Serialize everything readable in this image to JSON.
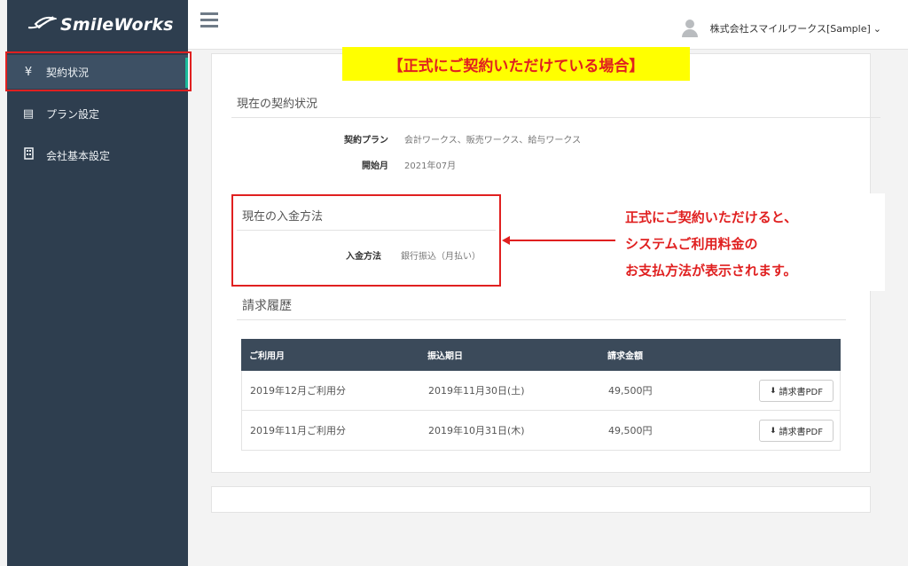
{
  "brand": {
    "logo_text": "SmileWorks"
  },
  "header": {
    "company": "株式会社スマイルワークス[Sample]",
    "chevron": "⌄"
  },
  "sidebar": {
    "items": [
      {
        "label": "契約状況",
        "icon": "yen-icon",
        "glyph": "¥",
        "active": true
      },
      {
        "label": "プラン設定",
        "icon": "list-icon",
        "glyph": "▤",
        "active": false
      },
      {
        "label": "会社基本設定",
        "icon": "building-icon",
        "glyph": "▯",
        "active": false
      }
    ]
  },
  "banner": {
    "text": "【正式にご契約いただけている場合】"
  },
  "contract": {
    "title": "現在の契約状況",
    "plan_label": "契約プラン",
    "plan_value": "会計ワークス、販売ワークス、給与ワークス",
    "start_label": "開始月",
    "start_value": "2021年07月"
  },
  "payment": {
    "title": "現在の入金方法",
    "method_label": "入金方法",
    "method_value": "銀行振込（月払い）"
  },
  "annotation": {
    "lines": [
      "正式にご契約いただけると、",
      "システムご利用料金の",
      "お支払方法が表示されます。"
    ]
  },
  "billing": {
    "title": "請求履歴",
    "columns": [
      "ご利用月",
      "振込期日",
      "請求金額"
    ],
    "rows": [
      {
        "month": "2019年12月ご利用分",
        "due": "2019年11月30日(土)",
        "amount": "49,500円",
        "button": "請求書PDF"
      },
      {
        "month": "2019年11月ご利用分",
        "due": "2019年10月31日(木)",
        "amount": "49,500円",
        "button": "請求書PDF"
      }
    ]
  },
  "colors": {
    "sidebar": "#2e3e4f",
    "accent": "#1abc9c",
    "highlight_red": "#e02020",
    "banner_bg": "#ffff00",
    "table_header": "#3b4a5a"
  }
}
